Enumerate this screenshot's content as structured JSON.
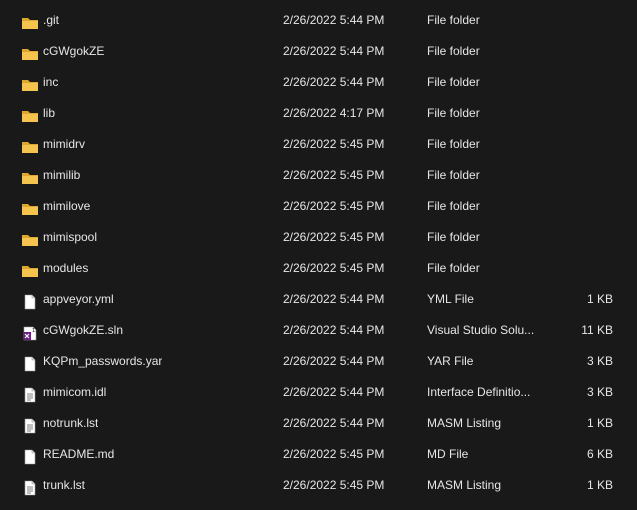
{
  "items": [
    {
      "name": ".git",
      "date": "2/26/2022 5:44 PM",
      "type": "File folder",
      "size": "",
      "icon": "folder-icon"
    },
    {
      "name": "cGWgokZE",
      "date": "2/26/2022 5:44 PM",
      "type": "File folder",
      "size": "",
      "icon": "folder-icon"
    },
    {
      "name": "inc",
      "date": "2/26/2022 5:44 PM",
      "type": "File folder",
      "size": "",
      "icon": "folder-icon"
    },
    {
      "name": "lib",
      "date": "2/26/2022 4:17 PM",
      "type": "File folder",
      "size": "",
      "icon": "folder-icon"
    },
    {
      "name": "mimidrv",
      "date": "2/26/2022 5:45 PM",
      "type": "File folder",
      "size": "",
      "icon": "folder-icon"
    },
    {
      "name": "mimilib",
      "date": "2/26/2022 5:45 PM",
      "type": "File folder",
      "size": "",
      "icon": "folder-icon"
    },
    {
      "name": "mimilove",
      "date": "2/26/2022 5:45 PM",
      "type": "File folder",
      "size": "",
      "icon": "folder-icon"
    },
    {
      "name": "mimispool",
      "date": "2/26/2022 5:45 PM",
      "type": "File folder",
      "size": "",
      "icon": "folder-icon"
    },
    {
      "name": "modules",
      "date": "2/26/2022 5:45 PM",
      "type": "File folder",
      "size": "",
      "icon": "folder-icon"
    },
    {
      "name": "appveyor.yml",
      "date": "2/26/2022 5:44 PM",
      "type": "YML File",
      "size": "1 KB",
      "icon": "file-icon"
    },
    {
      "name": "cGWgokZE.sln",
      "date": "2/26/2022 5:44 PM",
      "type": "Visual Studio Solu...",
      "size": "11 KB",
      "icon": "visual-studio-solution-icon"
    },
    {
      "name": "KQPm_passwords.yar",
      "date": "2/26/2022 5:44 PM",
      "type": "YAR File",
      "size": "3 KB",
      "icon": "file-icon"
    },
    {
      "name": "mimicom.idl",
      "date": "2/26/2022 5:44 PM",
      "type": "Interface Definitio...",
      "size": "3 KB",
      "icon": "text-file-icon"
    },
    {
      "name": "notrunk.lst",
      "date": "2/26/2022 5:44 PM",
      "type": "MASM Listing",
      "size": "1 KB",
      "icon": "text-file-icon"
    },
    {
      "name": "README.md",
      "date": "2/26/2022 5:45 PM",
      "type": "MD File",
      "size": "6 KB",
      "icon": "file-icon"
    },
    {
      "name": "trunk.lst",
      "date": "2/26/2022 5:45 PM",
      "type": "MASM Listing",
      "size": "1 KB",
      "icon": "text-file-icon"
    }
  ],
  "colors": {
    "background": "#191919",
    "text": "#e6e6e6",
    "folder": "#f4c44e",
    "folder_dark": "#dba632",
    "vs_purple": "#68217a"
  }
}
